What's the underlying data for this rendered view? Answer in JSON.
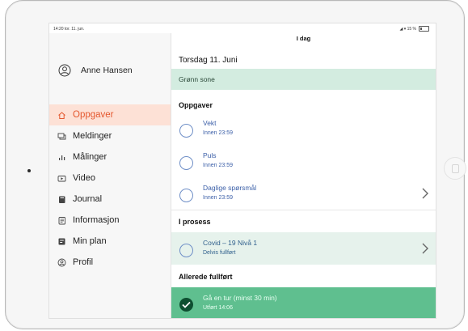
{
  "status": {
    "time": "14:20  tor. 11. jun.",
    "right": "◢ ▾ 15 %"
  },
  "sidebar": {
    "user_name": "Anne Hansen",
    "items": [
      {
        "label": "Oppgaver",
        "icon": "home-icon",
        "active": true
      },
      {
        "label": "Meldinger",
        "icon": "message-icon"
      },
      {
        "label": "Målinger",
        "icon": "bar-chart-icon"
      },
      {
        "label": "Video",
        "icon": "video-icon"
      },
      {
        "label": "Journal",
        "icon": "journal-icon"
      },
      {
        "label": "Informasjon",
        "icon": "info-document-icon"
      },
      {
        "label": "Min plan",
        "icon": "plan-icon"
      },
      {
        "label": "Profil",
        "icon": "profile-icon"
      }
    ]
  },
  "main": {
    "title": "I dag",
    "date": "Torsdag 11. Juni",
    "zone": "Grønn sone",
    "sections": {
      "tasks": "Oppgaver",
      "in_progress": "I prosess",
      "completed": "Allerede fullført"
    },
    "tasks": [
      {
        "title": "Vekt",
        "subtitle": "Innen 23:59"
      },
      {
        "title": "Puls",
        "subtitle": "Innen 23:59"
      },
      {
        "title": "Daglige spørsmål",
        "subtitle": "Innen 23:59"
      }
    ],
    "in_progress": [
      {
        "title": "Covid – 19 Nivå 1",
        "subtitle": "Delvis fullført"
      }
    ],
    "completed": [
      {
        "title": "Gå en tur (minst 30 min)",
        "subtitle": "Utført 14:06"
      }
    ]
  },
  "colors": {
    "accent": "#e4572e",
    "active_bg": "#fde1d6",
    "zone_bg": "#d3ece0",
    "done_bg": "#5fbf8f",
    "link": "#3b5fa8"
  }
}
